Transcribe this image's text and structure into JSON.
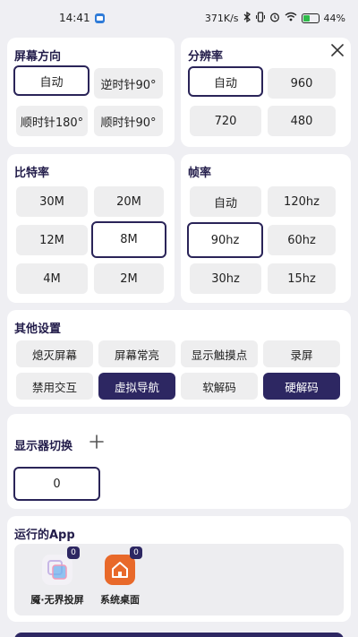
{
  "status_bar": {
    "time": "14:41",
    "net_speed": "371K/s",
    "battery": "44%",
    "battery_level": 0.44,
    "icons": [
      "app-notification-icon",
      "bluetooth-icon",
      "vibrate-icon",
      "alarm-icon",
      "wifi-icon",
      "battery-icon"
    ]
  },
  "orientation": {
    "title": "屏幕方向",
    "options": [
      "自动",
      "逆时针90°",
      "顺时针180°",
      "顺时针90°"
    ],
    "selected": "自动"
  },
  "resolution": {
    "title": "分辨率",
    "options": [
      "自动",
      "960",
      "720",
      "480"
    ],
    "selected": "自动"
  },
  "bitrate": {
    "title": "比特率",
    "options": [
      "30M",
      "20M",
      "12M",
      "8M",
      "4M",
      "2M"
    ],
    "selected": "8M"
  },
  "framerate": {
    "title": "帧率",
    "options": [
      "自动",
      "120hz",
      "90hz",
      "60hz",
      "30hz",
      "15hz"
    ],
    "selected": "90hz"
  },
  "other": {
    "title": "其他设置",
    "options": [
      "熄灭屏幕",
      "屏幕常亮",
      "显示触摸点",
      "录屏",
      "禁用交互",
      "虚拟导航",
      "软解码",
      "硬解码"
    ],
    "active": [
      "虚拟导航",
      "硬解码"
    ]
  },
  "display": {
    "title": "显示器切换",
    "options": [
      "0"
    ],
    "selected": "0"
  },
  "running_apps": {
    "title": "运行的App",
    "apps": [
      {
        "name": "魇·无界投屏",
        "badge": "0",
        "icon": "mirror-app-icon"
      },
      {
        "name": "系统桌面",
        "badge": "0",
        "icon": "home-icon"
      }
    ]
  },
  "colors": {
    "accent": "#2d2762",
    "background": "#efeff3",
    "button": "#eeeeef",
    "launcher_orange": "#e8692a"
  }
}
